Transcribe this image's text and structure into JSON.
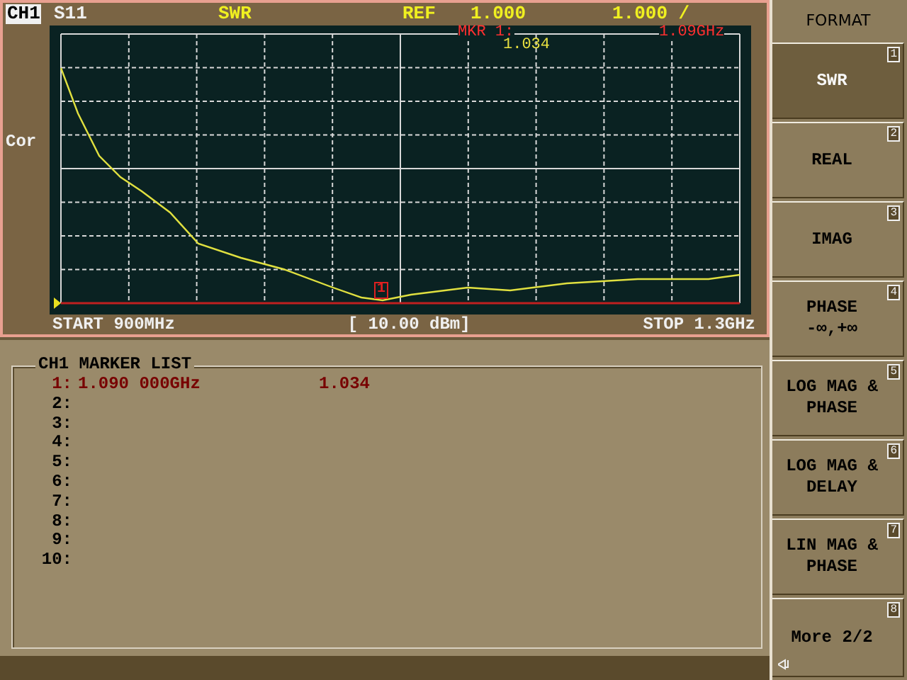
{
  "header": {
    "channel": "CH1",
    "parameter": "S11",
    "format": "SWR",
    "ref_label": "REF",
    "ref_value": "1.000",
    "scale": "1.000 /"
  },
  "plot": {
    "correction": "Cor",
    "marker_label": "MKR  1:",
    "marker_frequency": "1.09GHz",
    "marker_value": "1.034",
    "marker_flag": "1"
  },
  "footer": {
    "start": "START 900MHz",
    "power": "[ 10.00 dBm]",
    "stop": "STOP 1.3GHz"
  },
  "marker_list": {
    "title": "CH1 MARKER LIST",
    "rows": [
      {
        "index": "1:",
        "frequency": "1.090 000GHz",
        "value": "1.034",
        "active": true
      },
      {
        "index": "2:",
        "active": false
      },
      {
        "index": "3:",
        "active": false
      },
      {
        "index": "4:",
        "active": false
      },
      {
        "index": "5:",
        "active": false
      },
      {
        "index": "6:",
        "active": false
      },
      {
        "index": "7:",
        "active": false
      },
      {
        "index": "8:",
        "active": false
      },
      {
        "index": "9:",
        "active": false
      },
      {
        "index": "10:",
        "active": false
      }
    ]
  },
  "softkeys": {
    "title": "FORMAT",
    "keys": [
      {
        "kind": "key",
        "lines": [
          "SWR"
        ],
        "number": "1",
        "selected": true
      },
      {
        "kind": "key",
        "lines": [
          "REAL"
        ],
        "number": "2",
        "selected": false
      },
      {
        "kind": "key",
        "lines": [
          "IMAG"
        ],
        "number": "3",
        "selected": false
      },
      {
        "kind": "key",
        "lines": [
          "PHASE",
          "-∞,+∞"
        ],
        "number": "4",
        "selected": false
      },
      {
        "kind": "key",
        "lines": [
          "LOG MAG &",
          "PHASE"
        ],
        "number": "5",
        "selected": false
      },
      {
        "kind": "key",
        "lines": [
          "LOG MAG &",
          "DELAY"
        ],
        "number": "6",
        "selected": false
      },
      {
        "kind": "key",
        "lines": [
          "LIN MAG &",
          "PHASE"
        ],
        "number": "7",
        "selected": false
      },
      {
        "kind": "more",
        "lines": [
          "More 2/2"
        ],
        "number": "8",
        "selected": false
      }
    ]
  }
}
